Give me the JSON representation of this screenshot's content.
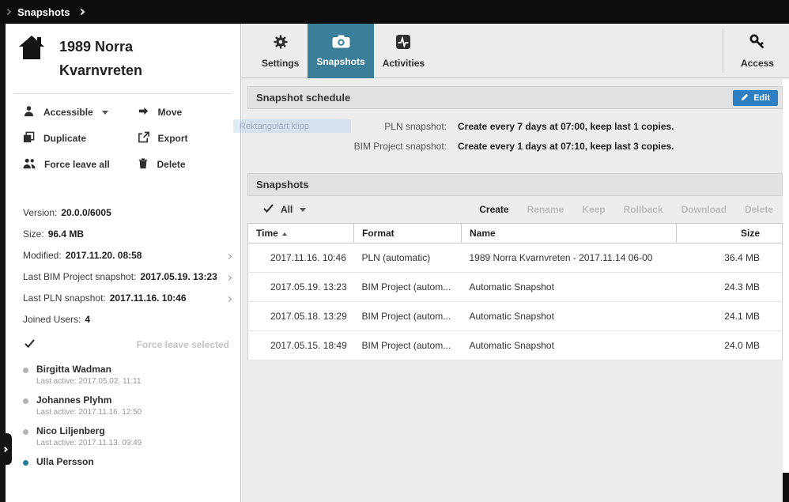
{
  "topbar": {
    "title": "Snapshots"
  },
  "sidebar": {
    "project_title": {
      "line1": "1989 Norra",
      "line2": "Kvarnvreten"
    },
    "actions": [
      {
        "label": "Accessible",
        "has_dropdown": true
      },
      {
        "label": "Move"
      },
      {
        "label": "Duplicate"
      },
      {
        "label": "Export"
      },
      {
        "label": "Force leave all"
      },
      {
        "label": "Delete"
      }
    ],
    "info": [
      {
        "label": "Version:",
        "value": "20.0.0/6005",
        "chevron": false
      },
      {
        "label": "Size:",
        "value": "96.4 MB",
        "chevron": false
      },
      {
        "label": "Modified:",
        "value": "2017.11.20. 08:58",
        "chevron": true
      },
      {
        "label": "Last BIM Project snapshot:",
        "value": "2017.05.19. 13:23",
        "chevron": true
      },
      {
        "label": "Last PLN snapshot:",
        "value": "2017.11.16. 10:46",
        "chevron": true
      },
      {
        "label": "Joined Users:",
        "value": "4",
        "chevron": false
      }
    ],
    "force_leave_selected": "Force leave selected",
    "users": [
      {
        "name": "Birgitta Wadman",
        "last_active": "Last active: 2017.05.02. 11:11",
        "online": false
      },
      {
        "name": "Johannes Plyhm",
        "last_active": "Last active: 2017.11.16. 12:50",
        "online": false
      },
      {
        "name": "Nico Liljenberg",
        "last_active": "Last active: 2017.11.13. 09:49",
        "online": false
      },
      {
        "name": "Ulla Persson",
        "online": true
      }
    ]
  },
  "tabs": {
    "settings": "Settings",
    "snapshots": "Snapshots",
    "activities": "Activities",
    "access": "Access",
    "active": "Snapshots"
  },
  "schedule": {
    "title": "Snapshot schedule",
    "edit_button": "Edit",
    "rows": [
      {
        "label": "PLN snapshot:",
        "value": "Create every 7 days at 07:00, keep last 1 copies."
      },
      {
        "label": "BIM Project snapshot:",
        "value": "Create every 1 days at 07:10, keep last 3 copies."
      }
    ]
  },
  "overlay": {
    "label": "Rektangulärt klipp"
  },
  "snapshots_section": {
    "title": "Snapshots",
    "filter": {
      "selected": "All"
    },
    "actions": [
      {
        "label": "Create",
        "enabled": true
      },
      {
        "label": "Rename",
        "enabled": false
      },
      {
        "label": "Keep",
        "enabled": false
      },
      {
        "label": "Rollback",
        "enabled": false
      },
      {
        "label": "Download",
        "enabled": false
      },
      {
        "label": "Delete",
        "enabled": false
      }
    ],
    "table": {
      "columns": {
        "time": "Time",
        "format": "Format",
        "name": "Name",
        "size": "Size"
      },
      "rows": [
        {
          "time": "2017.11.16. 10:46",
          "format": "PLN (automatic)",
          "name": "1989 Norra Kvarnvreten - 2017.11.14 06-00",
          "size": "36.4 MB"
        },
        {
          "time": "2017.05.19. 13:23",
          "format": "BIM Project (autom...",
          "name": "Automatic Snapshot",
          "size": "24.3 MB"
        },
        {
          "time": "2017.05.18. 13:29",
          "format": "BIM Project (autom...",
          "name": "Automatic Snapshot",
          "size": "24.1 MB"
        },
        {
          "time": "2017.05.15. 18:49",
          "format": "BIM Project (autom...",
          "name": "Automatic Snapshot",
          "size": "24.0 MB"
        }
      ]
    },
    "colors": {
      "active_tab": "#3a7e9a",
      "edit_button": "#2e7fc2",
      "topbar": "#0d0d0d"
    }
  }
}
